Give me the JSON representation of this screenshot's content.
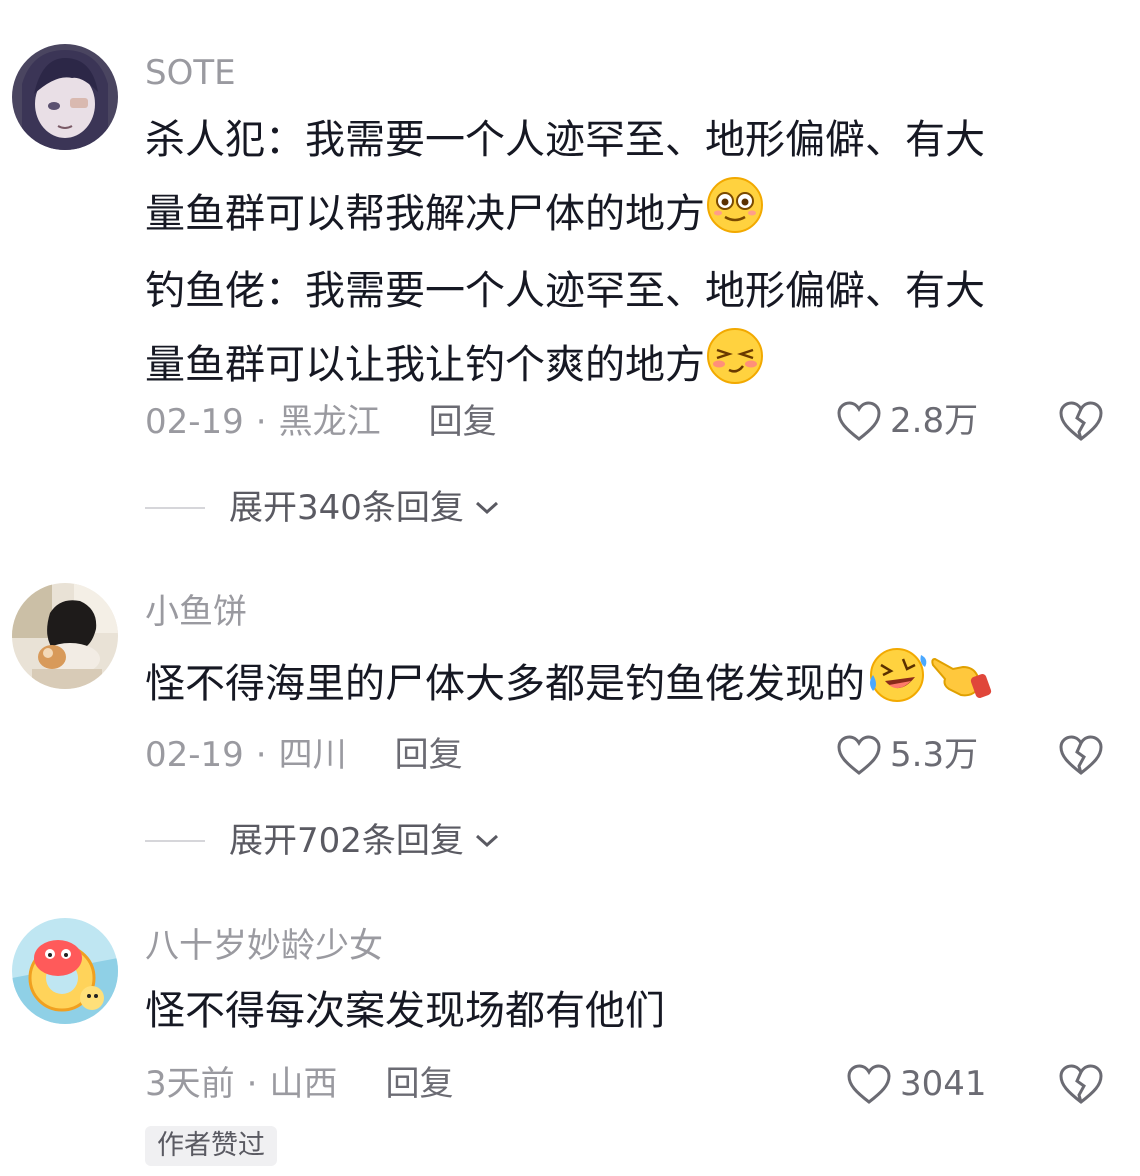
{
  "comments": [
    {
      "username": "SOTE",
      "lines": [
        "杀人犯：我需要一个人迹罕至、地形偏僻、有大",
        "量鱼群可以帮我解决尸体的地方",
        "钓鱼佬：我需要一个人迹罕至、地形偏僻、有大",
        "量鱼群可以让我让钓个爽的地方"
      ],
      "date": "02-19",
      "location": "黑龙江",
      "reply_label": "回复",
      "likes": "2.8万",
      "expand_label": "展开340条回复"
    },
    {
      "username": "小鱼饼",
      "lines": [
        "怪不得海里的尸体大多都是钓鱼佬发现的"
      ],
      "date": "02-19",
      "location": "四川",
      "reply_label": "回复",
      "likes": "5.3万",
      "expand_label": "展开702条回复"
    },
    {
      "username": "八十岁妙龄少女",
      "lines": [
        "怪不得每次案发现场都有他们"
      ],
      "date": "3天前",
      "location": "山西",
      "reply_label": "回复",
      "likes": "3041",
      "badge": "作者赞过"
    }
  ],
  "separator": "·",
  "icons": {
    "like": "heart-outline-icon",
    "dislike": "broken-heart-icon",
    "expand": "chevron-down-icon"
  },
  "colors": {
    "text": "#161823",
    "secondary": "#9a9aa0",
    "icon": "#6b6b73"
  }
}
